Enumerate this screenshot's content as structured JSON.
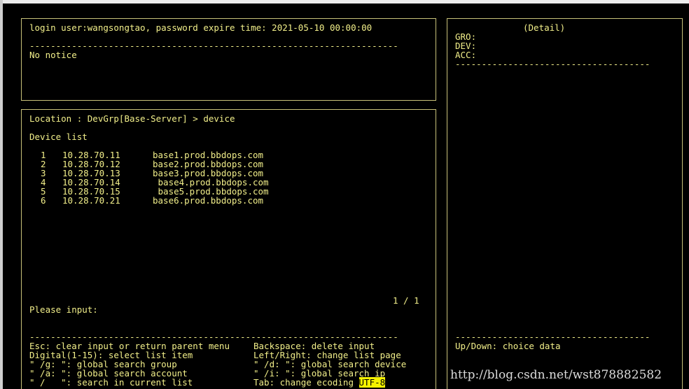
{
  "header": {
    "login_line": "login user:wangsongtao, password expire time: 2021-05-10 00:00:00",
    "divider": "----------------------------------------------------------------------",
    "notice": "No notice"
  },
  "main": {
    "location_line": "Location : DevGrp[Base-Server] > device",
    "list_title": "Device list",
    "devices": [
      {
        "idx": "1",
        "ip": "10.28.70.11",
        "host": "base1.prod.bbdops.com"
      },
      {
        "idx": "2",
        "ip": "10.28.70.12",
        "host": "base2.prod.bbdops.com"
      },
      {
        "idx": "3",
        "ip": "10.28.70.13",
        "host": "base3.prod.bbdops.com"
      },
      {
        "idx": "4",
        "ip": "10.28.70.14",
        "host": " base4.prod.bbdops.com"
      },
      {
        "idx": "5",
        "ip": "10.28.70.15",
        "host": " base5.prod.bbdops.com"
      },
      {
        "idx": "6",
        "ip": "10.28.70.21",
        "host": "base6.prod.bbdops.com"
      }
    ],
    "page_indicator": "1 / 1",
    "prompt": "Please input:",
    "divider": "----------------------------------------------------------------------"
  },
  "help": {
    "left": [
      "Esc: clear input or return parent menu",
      "Digital(1-15): select list item",
      "\" /g: \": global search group",
      "\" /a: \": global search account",
      "\" /   \": search in current list"
    ],
    "right": [
      "Backspace: delete input",
      "Left/Right: change list page",
      "\" /d: \": global search device",
      "\" /i: \": global search ip",
      "Tab: change ecoding "
    ],
    "encoding": "UTF-8"
  },
  "detail": {
    "title": "(Detail)",
    "gro_label": "GRO:",
    "dev_label": "DEV:",
    "acc_label": "ACC:",
    "divider": "-------------------------------------",
    "footer_divider": "-------------------------------------",
    "footer": "Up/Down: choice data"
  },
  "watermark": "http://blog.csdn.net/wst878882582"
}
